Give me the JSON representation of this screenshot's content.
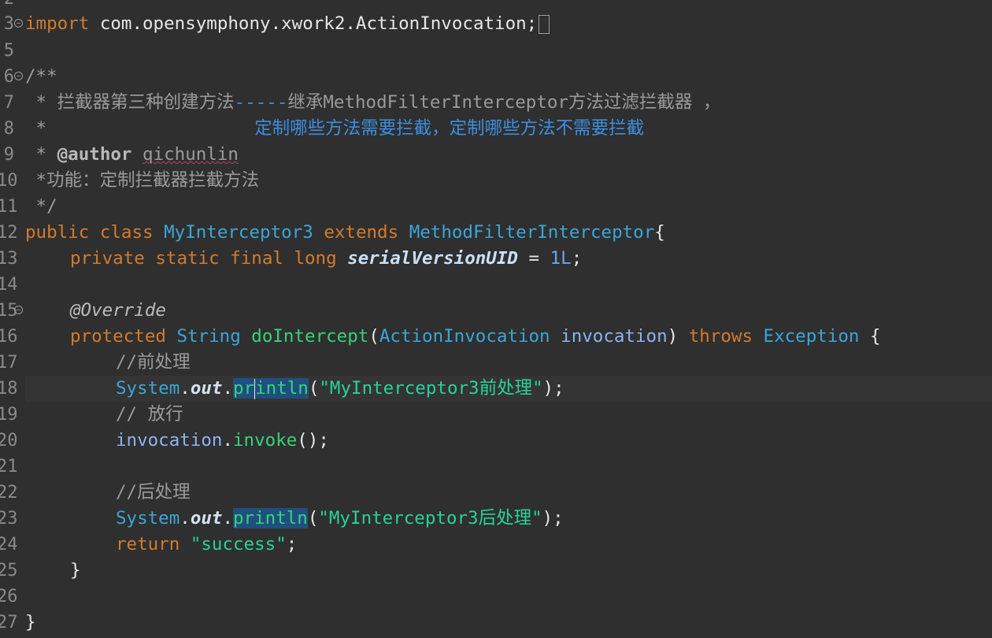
{
  "gutter": {
    "line_numbers": [
      "2",
      "3",
      "5",
      "6",
      "7",
      "8",
      "9",
      "10",
      "11",
      "12",
      "13",
      "14",
      "15",
      "16",
      "17",
      "18",
      "19",
      "20",
      "21",
      "22",
      "23",
      "24",
      "25",
      "26",
      "27"
    ]
  },
  "code": {
    "l3": {
      "kw": "import",
      "rest": " com.opensymphony.xwork2.ActionInvocation;"
    },
    "l6": "/**",
    "l7": {
      "prefix": " * 拦截器第三种创建方法",
      "dashes": "-----",
      "rest": "继承MethodFilterInterceptor方法过滤拦截器 ，"
    },
    "l8": {
      "prefix": " *",
      "rest": "定制哪些方法需要拦截，定制哪些方法不需要拦截"
    },
    "l9": {
      "prefix": " * ",
      "tag": "@author",
      "name": "qichunlin"
    },
    "l10": " *功能：定制拦截器拦截方法",
    "l11": " */",
    "l12": {
      "kw1": "public",
      "kw2": "class",
      "cls": "MyInterceptor3",
      "kw3": "extends",
      "sup": "MethodFilterInterceptor",
      "brace": "{"
    },
    "l13": {
      "kws": "private static final long",
      "field": "serialVersionUID",
      "eq": " = ",
      "num": "1L",
      "end": ";"
    },
    "l15": "@Override",
    "l16": {
      "kw": "protected",
      "type": "String",
      "method": "doIntercept",
      "lp": "(",
      "ptype": "ActionInvocation",
      "param": "invocation",
      "rp": ")",
      "kw2": "throws",
      "exc": "Exception",
      "brace": "{"
    },
    "l17": "//前处理",
    "l18": {
      "sys": "System",
      "dot1": ".",
      "out": "out",
      "dot2": ".",
      "m1": "pr",
      "m2": "intln",
      "lp": "(",
      "str": "\"MyInterceptor3前处理\"",
      "end": ");"
    },
    "l19": "// 放行",
    "l20": {
      "obj": "invocation",
      "dot": ".",
      "method": "invoke",
      "end": "();"
    },
    "l22": "//后处理",
    "l23": {
      "sys": "System",
      "dot1": ".",
      "out": "out",
      "dot2": ".",
      "method": "println",
      "lp": "(",
      "str": "\"MyInterceptor3后处理\"",
      "end": ");"
    },
    "l24": {
      "kw": "return",
      "str": "\"success\"",
      "end": ";"
    },
    "l25": "}",
    "l27": "}"
  }
}
